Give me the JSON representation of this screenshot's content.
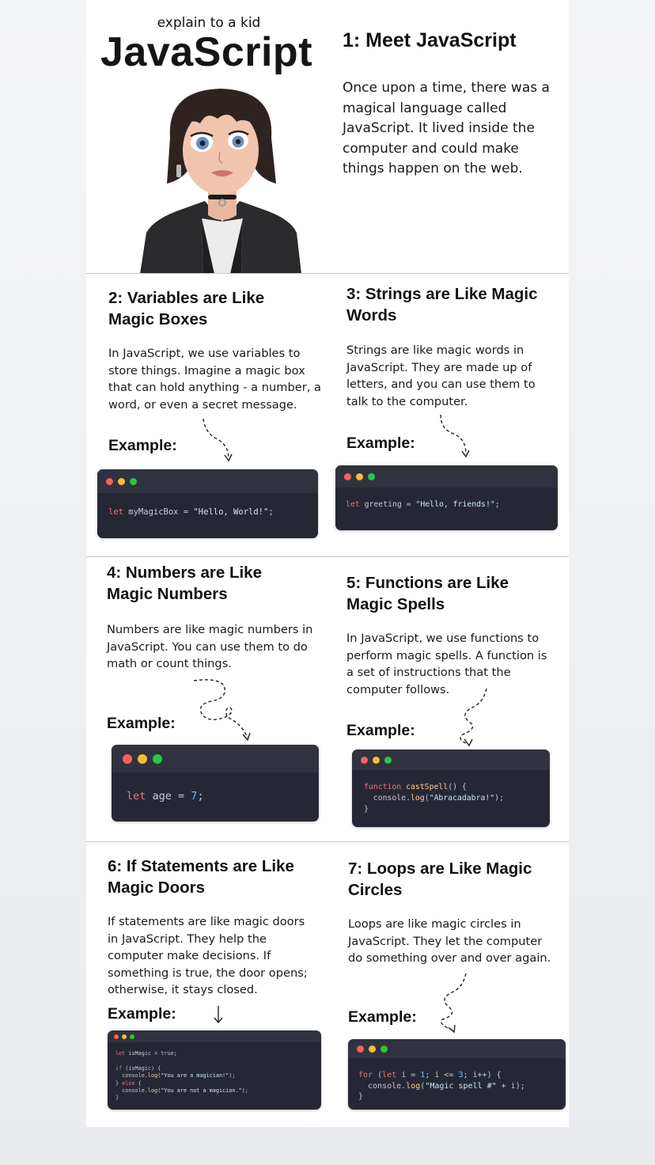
{
  "header": {
    "kicker": "explain to a kid",
    "title": "JavaScript"
  },
  "sections": [
    {
      "heading": "1: Meet JavaScript",
      "body": "Once upon a time, there was a magical language called JavaScript. It lived inside the computer and could make things happen on the web."
    },
    {
      "heading": "2: Variables are Like Magic Boxes",
      "body": "In JavaScript, we use variables to store things. Imagine a magic box that can hold anything - a number, a word, or even a secret message.",
      "example_label": "Example:",
      "code": [
        "let myMagicBox = \"Hello, World!\";"
      ]
    },
    {
      "heading": "3: Strings are Like Magic Words",
      "body": "Strings are like magic words in JavaScript. They are made up of letters, and you can use them to talk to the computer.",
      "example_label": "Example:",
      "code": [
        "let greeting = \"Hello, friends!\";"
      ]
    },
    {
      "heading": "4: Numbers are Like Magic Numbers",
      "body": "Numbers are like magic numbers in JavaScript. You can use them to do math or count things.",
      "example_label": "Example:",
      "code": [
        "let age = 7;"
      ]
    },
    {
      "heading": "5: Functions are Like Magic Spells",
      "body": "In JavaScript, we use functions to perform magic spells. A function is a set of instructions that the computer follows.",
      "example_label": "Example:",
      "code": [
        "function castSpell() {",
        "  console.log(\"Abracadabra!\");",
        "}"
      ]
    },
    {
      "heading": "6: If Statements are Like Magic Doors",
      "body": "If statements are like magic doors in JavaScript. They help the computer make decisions. If something is true, the door opens; otherwise, it stays closed.",
      "example_label": "Example:",
      "code": [
        "let isMagic = true;",
        "",
        "if (isMagic) {",
        "  console.log(\"You are a magician!\");",
        "} else {",
        "  console.log(\"You are not a magician.\");",
        "}"
      ]
    },
    {
      "heading": "7: Loops are Like Magic Circles",
      "body": "Loops are like magic circles in JavaScript. They let the computer do something over and over again.",
      "example_label": "Example:",
      "code": [
        "for (let i = 1; i <= 3; i++) {",
        "  console.log(\"Magic spell #\" + i);",
        "}"
      ]
    }
  ],
  "colors": {
    "code_bg": "#252834",
    "dot_red": "#ff5f57",
    "dot_yellow": "#febc2e",
    "dot_green": "#28c840"
  },
  "illustration": "girl-character-illustration"
}
